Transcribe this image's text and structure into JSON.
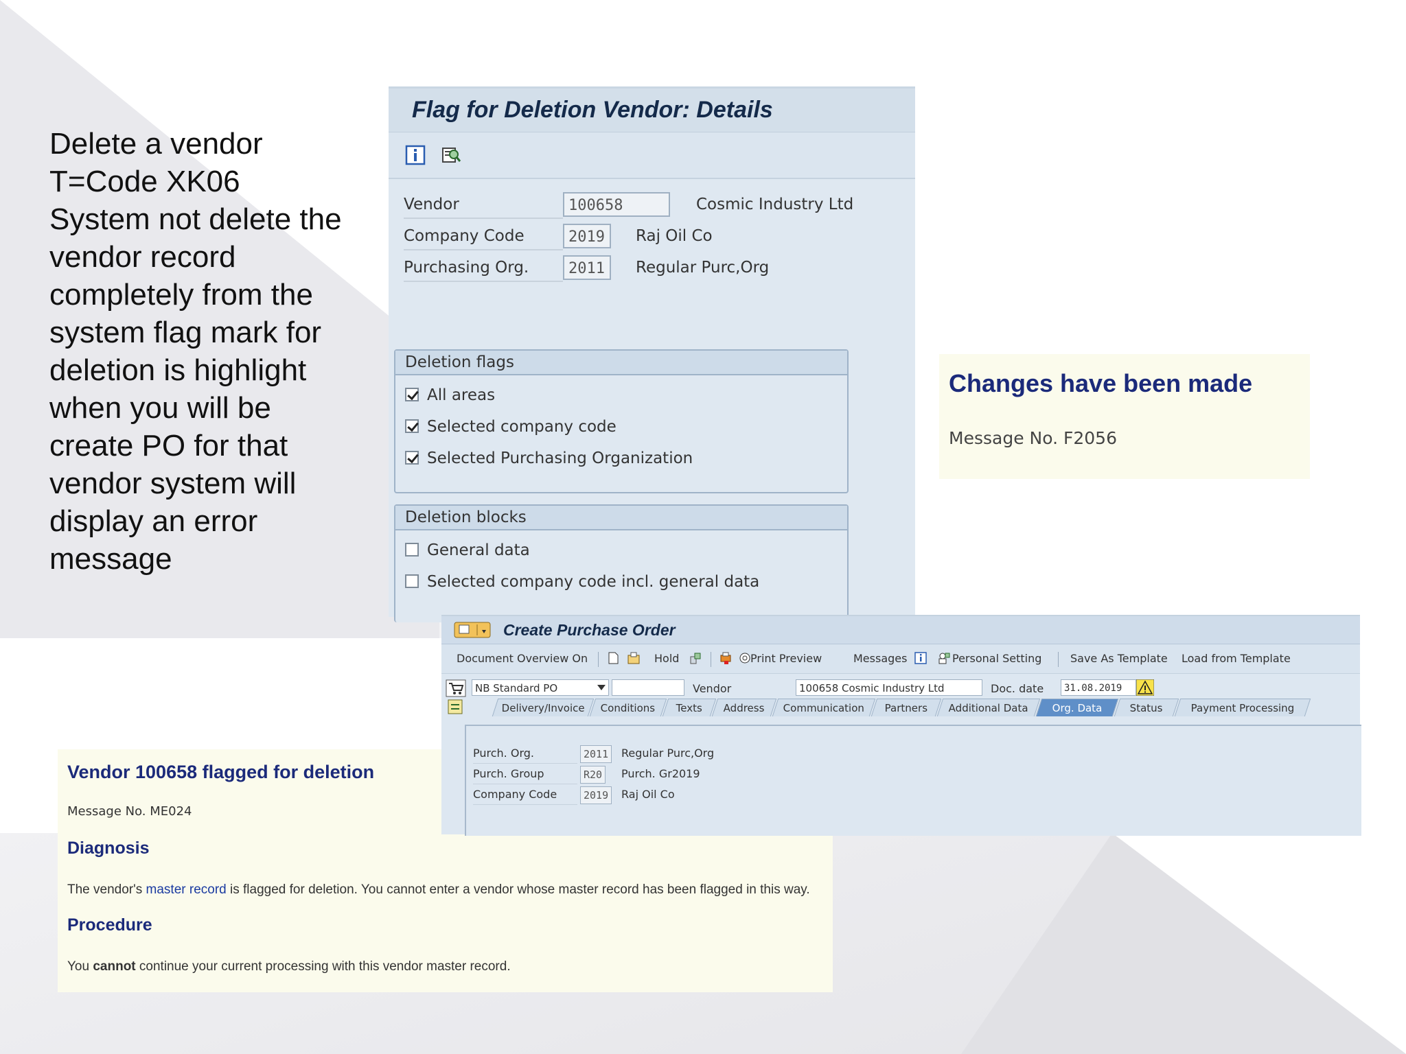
{
  "intro": {
    "lines": [
      "Delete a vendor",
      "T=Code XK06",
      "System not delete the",
      "vendor record",
      "completely from the",
      "system flag mark for",
      "deletion is highlight",
      "when you will be",
      "create PO for that",
      "vendor system will",
      "display an error",
      "message"
    ]
  },
  "flag_window": {
    "title": "Flag for Deletion Vendor: Details",
    "toolbar_icons": [
      "info-icon",
      "display-search-icon"
    ],
    "fields": {
      "vendor": {
        "label": "Vendor",
        "value": "100658",
        "desc": "Cosmic Industry Ltd"
      },
      "company_code": {
        "label": "Company Code",
        "value": "2019",
        "desc": "Raj Oil Co"
      },
      "purch_org": {
        "label": "Purchasing Org.",
        "value": "2011",
        "desc": "Regular Purc,Org"
      }
    },
    "deletion_flags": {
      "title": "Deletion flags",
      "items": [
        {
          "label": "All areas",
          "checked": true
        },
        {
          "label": "Selected company code",
          "checked": true
        },
        {
          "label": "Selected Purchasing Organization",
          "checked": true
        }
      ]
    },
    "deletion_blocks": {
      "title": "Deletion blocks",
      "items": [
        {
          "label": "General data",
          "checked": false
        },
        {
          "label": "Selected company code incl. general data",
          "checked": false
        }
      ]
    }
  },
  "changes_message": {
    "title": "Changes have been made",
    "number": "Message No. F2056"
  },
  "po_window": {
    "title": "Create Purchase Order",
    "menu": {
      "doc_overview": "Document Overview On",
      "hold": "Hold",
      "print_preview": "Print Preview",
      "messages": "Messages",
      "personal_setting": "Personal Setting",
      "save_template": "Save As Template",
      "load_template": "Load from Template"
    },
    "header": {
      "order_type": "NB Standard PO",
      "vendor_label": "Vendor",
      "vendor_value": "100658 Cosmic Industry Ltd",
      "doc_date_label": "Doc. date",
      "doc_date_value": "31.08.2019"
    },
    "tabs": [
      "Delivery/Invoice",
      "Conditions",
      "Texts",
      "Address",
      "Communication",
      "Partners",
      "Additional Data",
      "Org. Data",
      "Status",
      "Payment Processing"
    ],
    "active_tab": "Org. Data",
    "org_data": {
      "purch_org": {
        "label": "Purch. Org.",
        "value": "2011",
        "desc": "Regular Purc,Org"
      },
      "purch_group": {
        "label": "Purch. Group",
        "value": "R20",
        "desc": "Purch. Gr2019"
      },
      "company_code": {
        "label": "Company Code",
        "value": "2019",
        "desc": "Raj Oil Co"
      }
    }
  },
  "vendor_message": {
    "title": "Vendor 100658 flagged for deletion",
    "number": "Message No. ME024",
    "diagnosis_title": "Diagnosis",
    "diagnosis_pre": "The vendor's ",
    "diagnosis_link": "master record",
    "diagnosis_post": " is flagged for deletion. You cannot enter a vendor whose master record has been flagged in this way.",
    "procedure_title": "Procedure",
    "procedure_pre": "You ",
    "procedure_strong": "cannot",
    "procedure_post": " continue your current processing with this vendor master record."
  },
  "colors": {
    "heading_blue": "#1b2a7a",
    "message_bg": "#fbfbec",
    "sap_panel_bg": "#dfe8f1",
    "active_tab": "#5f8fc8"
  }
}
